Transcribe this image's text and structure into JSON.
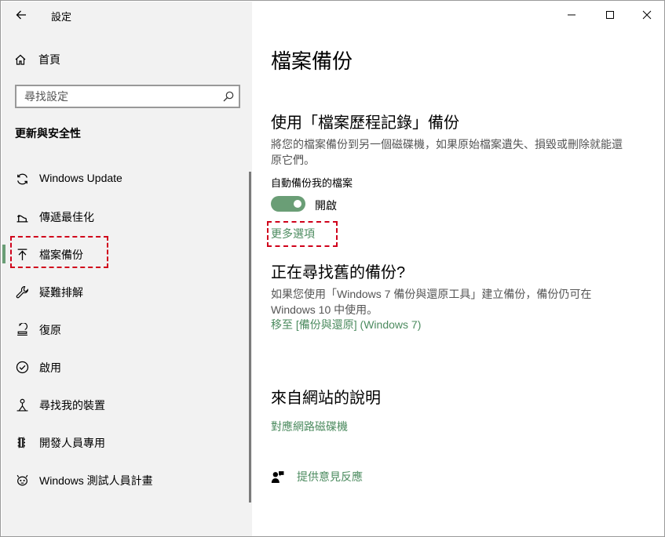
{
  "window": {
    "title": "設定",
    "controls": {
      "minimize": "minimize",
      "maximize": "maximize",
      "close": "close"
    }
  },
  "sidebar": {
    "home_label": "首頁",
    "search_placeholder": "尋找設定",
    "section_header": "更新與安全性",
    "items": [
      {
        "label": "Windows Update",
        "icon": "sync-icon"
      },
      {
        "label": "傳遞最佳化",
        "icon": "delivery-optimization-icon"
      },
      {
        "label": "檔案備份",
        "icon": "backup-arrow-icon",
        "selected": true
      },
      {
        "label": "疑難排解",
        "icon": "wrench-icon"
      },
      {
        "label": "復原",
        "icon": "recovery-icon"
      },
      {
        "label": "啟用",
        "icon": "check-circle-icon"
      },
      {
        "label": "尋找我的裝置",
        "icon": "find-device-icon"
      },
      {
        "label": "開發人員專用",
        "icon": "developer-icon"
      },
      {
        "label": "Windows 測試人員計畫",
        "icon": "insider-icon"
      }
    ]
  },
  "main": {
    "page_title": "檔案備份",
    "file_history": {
      "title": "使用「檔案歷程記錄」備份",
      "description": "將您的檔案備份到另一個磁碟機，如果原始檔案遺失、損毀或刪除就能還原它們。",
      "auto_backup_label": "自動備份我的檔案",
      "toggle_state": "開啟",
      "toggle_on": true,
      "more_options": "更多選項"
    },
    "older_backup": {
      "title": "正在尋找舊的備份?",
      "description": "如果您使用「Windows 7 備份與還原工具」建立備份，備份仍可在 Windows 10 中使用。",
      "link": "移至 [備份與還原] (Windows 7)"
    },
    "web_help": {
      "title": "來自網站的說明",
      "link": "對應網路磁碟機"
    },
    "feedback_label": "提供意見反應"
  },
  "colors": {
    "accent": "#6a9e76",
    "link": "#4c8b5f",
    "highlight": "#d0021b",
    "sidebar_bg": "#f2f2f2"
  }
}
